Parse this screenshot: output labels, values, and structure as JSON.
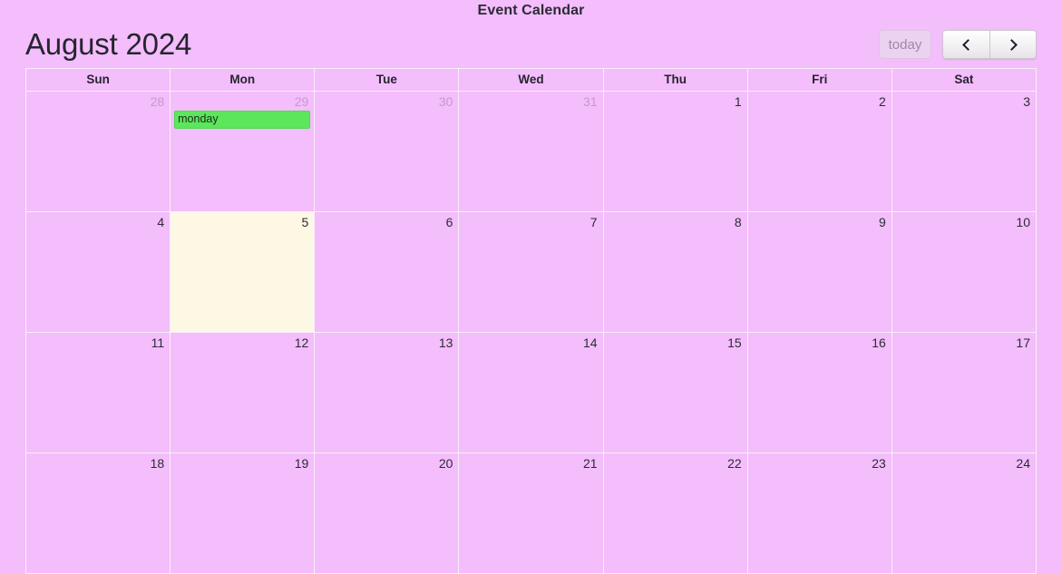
{
  "page": {
    "title": "Event Calendar"
  },
  "toolbar": {
    "title": "August 2024",
    "today_label": "today",
    "prev_label": "prev",
    "next_label": "next"
  },
  "theme": {
    "background": "#f4bdfb",
    "gridline": "#fbeefd",
    "today_cell": "#fdf8e4",
    "event_green": "#5ce65c",
    "text": "#2b2b38",
    "muted_text": "#c39bcb"
  },
  "weekdays": [
    "Sun",
    "Mon",
    "Tue",
    "Wed",
    "Thu",
    "Fri",
    "Sat"
  ],
  "weeks": [
    {
      "days": [
        {
          "num": "28",
          "other_month": true,
          "today": false,
          "events": []
        },
        {
          "num": "29",
          "other_month": true,
          "today": false,
          "events": [
            {
              "title": "monday",
              "color": "#5ce65c"
            }
          ]
        },
        {
          "num": "30",
          "other_month": true,
          "today": false,
          "events": []
        },
        {
          "num": "31",
          "other_month": true,
          "today": false,
          "events": []
        },
        {
          "num": "1",
          "other_month": false,
          "today": false,
          "events": []
        },
        {
          "num": "2",
          "other_month": false,
          "today": false,
          "events": []
        },
        {
          "num": "3",
          "other_month": false,
          "today": false,
          "events": []
        }
      ]
    },
    {
      "days": [
        {
          "num": "4",
          "other_month": false,
          "today": false,
          "events": []
        },
        {
          "num": "5",
          "other_month": false,
          "today": true,
          "events": []
        },
        {
          "num": "6",
          "other_month": false,
          "today": false,
          "events": []
        },
        {
          "num": "7",
          "other_month": false,
          "today": false,
          "events": []
        },
        {
          "num": "8",
          "other_month": false,
          "today": false,
          "events": []
        },
        {
          "num": "9",
          "other_month": false,
          "today": false,
          "events": []
        },
        {
          "num": "10",
          "other_month": false,
          "today": false,
          "events": []
        }
      ]
    },
    {
      "days": [
        {
          "num": "11",
          "other_month": false,
          "today": false,
          "events": []
        },
        {
          "num": "12",
          "other_month": false,
          "today": false,
          "events": []
        },
        {
          "num": "13",
          "other_month": false,
          "today": false,
          "events": []
        },
        {
          "num": "14",
          "other_month": false,
          "today": false,
          "events": []
        },
        {
          "num": "15",
          "other_month": false,
          "today": false,
          "events": []
        },
        {
          "num": "16",
          "other_month": false,
          "today": false,
          "events": []
        },
        {
          "num": "17",
          "other_month": false,
          "today": false,
          "events": []
        }
      ]
    },
    {
      "days": [
        {
          "num": "18",
          "other_month": false,
          "today": false,
          "events": []
        },
        {
          "num": "19",
          "other_month": false,
          "today": false,
          "events": []
        },
        {
          "num": "20",
          "other_month": false,
          "today": false,
          "events": []
        },
        {
          "num": "21",
          "other_month": false,
          "today": false,
          "events": []
        },
        {
          "num": "22",
          "other_month": false,
          "today": false,
          "events": []
        },
        {
          "num": "23",
          "other_month": false,
          "today": false,
          "events": []
        },
        {
          "num": "24",
          "other_month": false,
          "today": false,
          "events": []
        }
      ]
    }
  ]
}
